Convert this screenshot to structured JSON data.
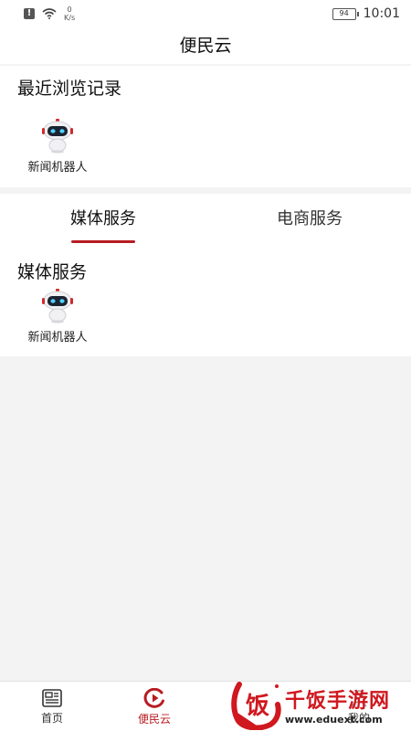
{
  "status_bar": {
    "speed_value": "0",
    "speed_unit": "K/s",
    "battery": "94",
    "time": "10:01"
  },
  "header": {
    "title": "便民云"
  },
  "recent": {
    "title": "最近浏览记录",
    "items": [
      {
        "label": "新闻机器人",
        "icon": "robot-icon"
      }
    ]
  },
  "tabs": [
    {
      "label": "媒体服务",
      "active": true
    },
    {
      "label": "电商服务",
      "active": false
    }
  ],
  "media_section": {
    "title": "媒体服务",
    "items": [
      {
        "label": "新闻机器人",
        "icon": "robot-icon"
      }
    ]
  },
  "bottom_nav": [
    {
      "label": "首页",
      "icon": "newspaper-icon",
      "active": false
    },
    {
      "label": "便民云",
      "icon": "play-circle-icon",
      "active": true
    },
    {
      "label": "",
      "icon": "",
      "active": false
    },
    {
      "label": "我的",
      "icon": "user-icon",
      "active": false
    }
  ],
  "watermark": {
    "glyph": "饭",
    "text": "千饭手游网",
    "url": "www.eduext.com"
  },
  "colors": {
    "accent": "#b81c22",
    "background": "#f3f3f3",
    "card": "#ffffff"
  }
}
